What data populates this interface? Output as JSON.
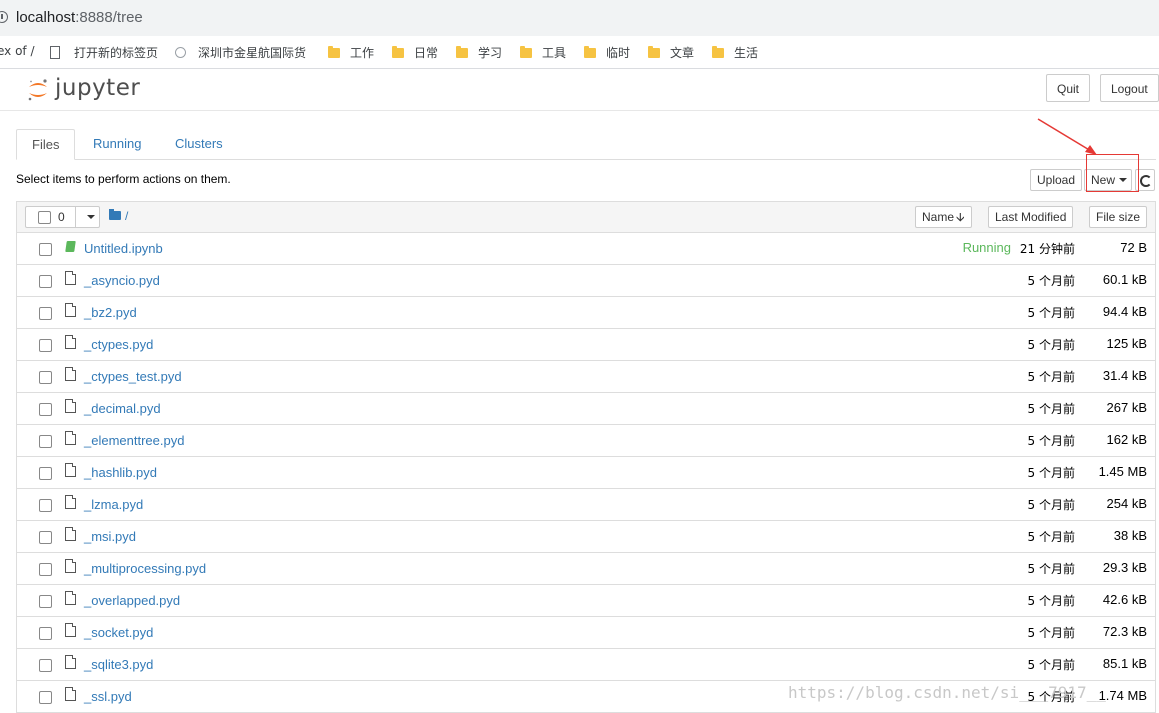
{
  "browser": {
    "url_host": "localhost",
    "url_path": ":8888/tree",
    "bookmarks": [
      {
        "label": "ex of /",
        "icon": "none"
      },
      {
        "label": "打开新的标签页",
        "icon": "page-icon"
      },
      {
        "label": "深圳市金星航国际货",
        "icon": "globe-icon"
      },
      {
        "label": "工作",
        "icon": "folder-icon"
      },
      {
        "label": "日常",
        "icon": "folder-icon"
      },
      {
        "label": "学习",
        "icon": "folder-icon"
      },
      {
        "label": "工具",
        "icon": "folder-icon"
      },
      {
        "label": "临时",
        "icon": "folder-icon"
      },
      {
        "label": "文章",
        "icon": "folder-icon"
      },
      {
        "label": "生活",
        "icon": "folder-icon"
      }
    ]
  },
  "header": {
    "logo_text": "jupyter",
    "quit_label": "Quit",
    "logout_label": "Logout"
  },
  "tabs": [
    {
      "label": "Files",
      "active": true
    },
    {
      "label": "Running",
      "active": false
    },
    {
      "label": "Clusters",
      "active": false
    }
  ],
  "toolbar": {
    "hint": "Select items to perform actions on them.",
    "upload_label": "Upload",
    "new_label": "New"
  },
  "list_header": {
    "selected_count": "0",
    "breadcrumb": "/",
    "name_label": "Name",
    "last_modified_label": "Last Modified",
    "file_size_label": "File size"
  },
  "files": [
    {
      "name": "Untitled.ipynb",
      "type": "notebook",
      "status": "Running",
      "modified": "21 分钟前",
      "size": "72 B"
    },
    {
      "name": "_asyncio.pyd",
      "type": "file",
      "status": "",
      "modified": "5 个月前",
      "size": "60.1 kB"
    },
    {
      "name": "_bz2.pyd",
      "type": "file",
      "status": "",
      "modified": "5 个月前",
      "size": "94.4 kB"
    },
    {
      "name": "_ctypes.pyd",
      "type": "file",
      "status": "",
      "modified": "5 个月前",
      "size": "125 kB"
    },
    {
      "name": "_ctypes_test.pyd",
      "type": "file",
      "status": "",
      "modified": "5 个月前",
      "size": "31.4 kB"
    },
    {
      "name": "_decimal.pyd",
      "type": "file",
      "status": "",
      "modified": "5 个月前",
      "size": "267 kB"
    },
    {
      "name": "_elementtree.pyd",
      "type": "file",
      "status": "",
      "modified": "5 个月前",
      "size": "162 kB"
    },
    {
      "name": "_hashlib.pyd",
      "type": "file",
      "status": "",
      "modified": "5 个月前",
      "size": "1.45 MB"
    },
    {
      "name": "_lzma.pyd",
      "type": "file",
      "status": "",
      "modified": "5 个月前",
      "size": "254 kB"
    },
    {
      "name": "_msi.pyd",
      "type": "file",
      "status": "",
      "modified": "5 个月前",
      "size": "38 kB"
    },
    {
      "name": "_multiprocessing.pyd",
      "type": "file",
      "status": "",
      "modified": "5 个月前",
      "size": "29.3 kB"
    },
    {
      "name": "_overlapped.pyd",
      "type": "file",
      "status": "",
      "modified": "5 个月前",
      "size": "42.6 kB"
    },
    {
      "name": "_socket.pyd",
      "type": "file",
      "status": "",
      "modified": "5 个月前",
      "size": "72.3 kB"
    },
    {
      "name": "_sqlite3.pyd",
      "type": "file",
      "status": "",
      "modified": "5 个月前",
      "size": "85.1 kB"
    },
    {
      "name": "_ssl.pyd",
      "type": "file",
      "status": "",
      "modified": "5 个月前",
      "size": "1.74 MB"
    }
  ],
  "watermark": "https://blog.csdn.net/si___7917__",
  "colors": {
    "link": "#337ab7",
    "running": "#5cb85c",
    "annotation": "#e53935"
  }
}
